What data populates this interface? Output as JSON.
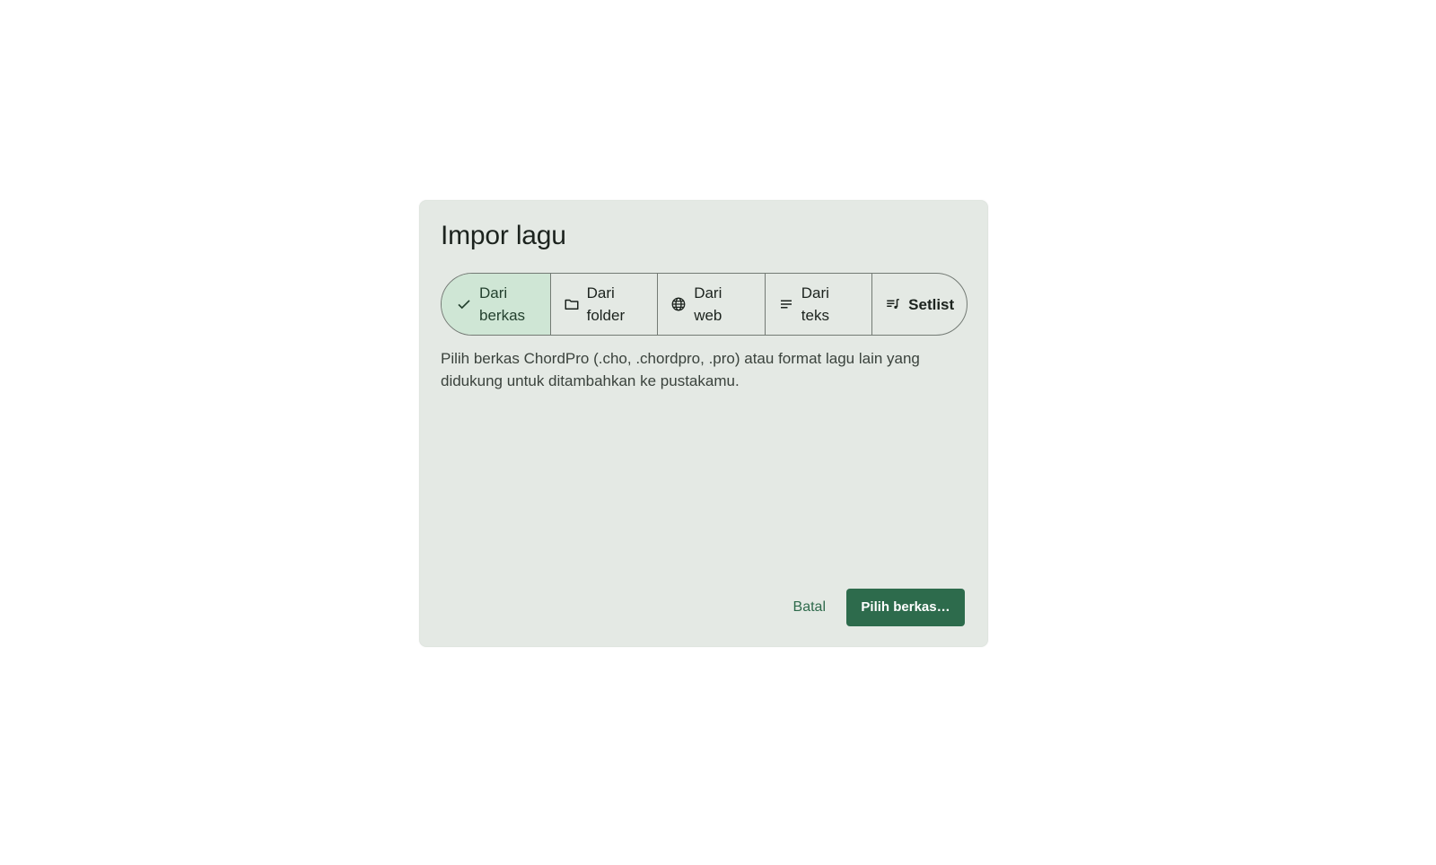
{
  "dialog": {
    "title": "Impor lagu",
    "tabs": [
      {
        "label": "Dari berkas",
        "icon": "check-icon",
        "selected": true
      },
      {
        "label": "Dari folder",
        "icon": "folder-icon",
        "selected": false
      },
      {
        "label": "Dari web",
        "icon": "globe-icon",
        "selected": false
      },
      {
        "label": "Dari teks",
        "icon": "text-lines-icon",
        "selected": false
      },
      {
        "label": "Setlist",
        "icon": "queue-music-icon",
        "selected": false
      }
    ],
    "description": "Pilih berkas ChordPro (.cho, .chordpro, .pro) atau format lagu lain yang didukung untuk ditambahkan ke pustakamu.",
    "cancel_label": "Batal",
    "confirm_label": "Pilih berkas…"
  },
  "colors": {
    "dialog_bg": "#e4e9e4",
    "selected_segment_bg": "#cfe6d5",
    "primary": "#2d6b4c"
  }
}
